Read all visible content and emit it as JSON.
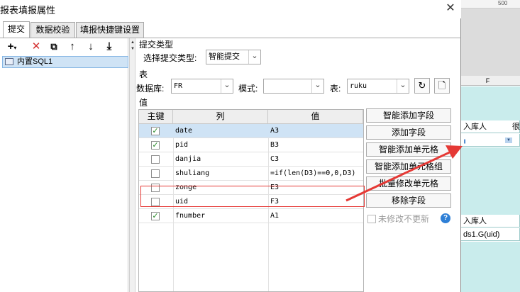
{
  "dialog": {
    "title": "报表填报属性",
    "tabs": [
      {
        "label": "提交",
        "active": true
      },
      {
        "label": "数据校验",
        "active": false
      },
      {
        "label": "填报快捷键设置",
        "active": false
      }
    ]
  },
  "left_panel": {
    "toolbar": [
      "add-icon",
      "delete-icon",
      "copy-icon",
      "move-up-icon",
      "move-down-icon",
      "move-bottom-icon"
    ],
    "items": [
      {
        "label": "内置SQL1",
        "selected": true
      }
    ]
  },
  "submit_type": {
    "section_label": "提交类型",
    "select_label": "选择提交类型:",
    "value": "智能提交"
  },
  "table_section": {
    "section_label": "表",
    "db_label": "数据库:",
    "db_value": "FR",
    "schema_label": "模式:",
    "schema_value": "",
    "table_label": "表:",
    "table_value": "ruku"
  },
  "values_section": {
    "section_label": "值",
    "headers": {
      "key": "主键",
      "column": "列",
      "value": "值"
    },
    "rows": [
      {
        "key": true,
        "column": "date",
        "value": "A3",
        "selected": true
      },
      {
        "key": true,
        "column": "pid",
        "value": "B3",
        "selected": false
      },
      {
        "key": false,
        "column": "danjia",
        "value": "C3",
        "selected": false
      },
      {
        "key": false,
        "column": "shuliang",
        "value": "=if(len(D3)==0,0,D3)",
        "selected": false
      },
      {
        "key": false,
        "column": "zonge",
        "value": "E3",
        "selected": false
      },
      {
        "key": false,
        "column": "uid",
        "value": "F3",
        "selected": false
      },
      {
        "key": true,
        "column": "fnumber",
        "value": "A1",
        "selected": false
      }
    ]
  },
  "actions": {
    "smart_add_field": "智能添加字段",
    "add_field": "添加字段",
    "smart_add_cell": "智能添加单元格",
    "smart_add_cell_group": "智能添加单元格组",
    "batch_modify_cell": "批量修改单元格",
    "remove_field": "移除字段",
    "no_update_label": "未修改不更新"
  },
  "sheet": {
    "ruler_number": "500",
    "column_header": "F",
    "cells": {
      "header1": "入库人",
      "header1_next": "很",
      "header2": "入库人",
      "formula": "ds1.G(uid)"
    }
  },
  "colors": {
    "selection": "#cfe3f5",
    "annotation_red": "#e53935",
    "sheet_teal": "#c9ecec",
    "check_green": "#2a8a2a"
  }
}
